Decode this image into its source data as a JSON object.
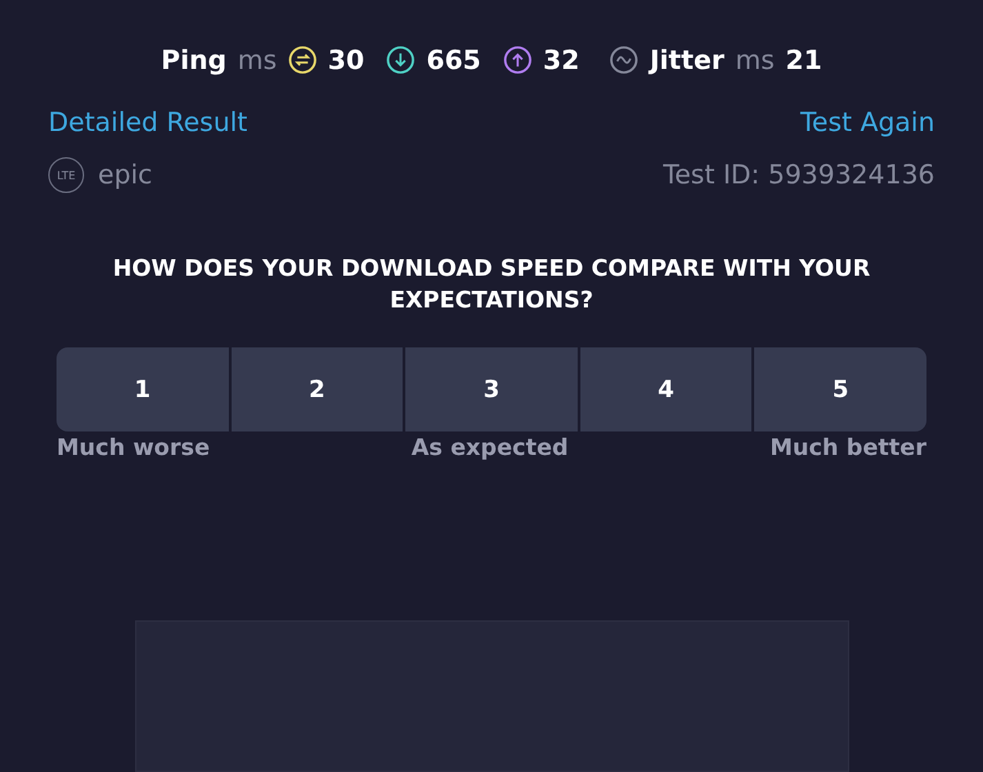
{
  "stats": {
    "ping_label": "Ping",
    "ping_unit": "ms",
    "idle": "30",
    "download": "665",
    "upload": "32",
    "jitter_label": "Jitter",
    "jitter_unit": "ms",
    "jitter": "21"
  },
  "links": [
    {
      "label": "Detailed Result"
    },
    {
      "label": "Test Again"
    }
  ],
  "connection": {
    "badge": "LTE",
    "provider": "epic",
    "test_id": "Test ID: 5939324136"
  },
  "survey": {
    "question": "HOW DOES YOUR DOWNLOAD SPEED COMPARE WITH YOUR EXPECTATIONS?",
    "options": [
      {
        "label": "1",
        "selected": false
      },
      {
        "label": "2",
        "selected": false
      },
      {
        "label": "3",
        "selected": false
      },
      {
        "label": "4",
        "selected": false
      },
      {
        "label": "5",
        "selected": false
      }
    ],
    "scale": [
      "Much worse",
      "As expected",
      "Much better"
    ]
  },
  "ad": {
    "kind": "placeholder"
  }
}
